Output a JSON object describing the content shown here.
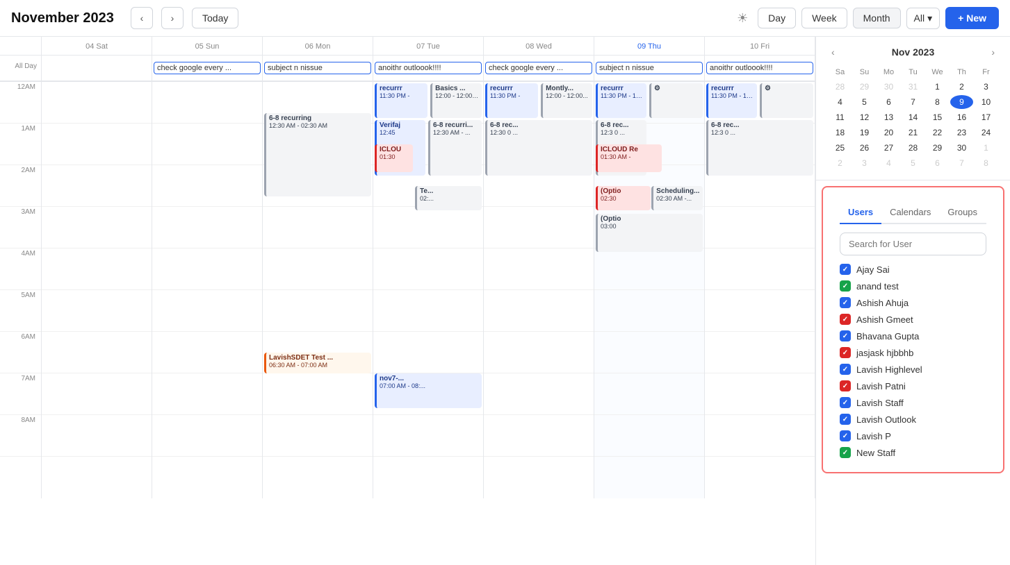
{
  "header": {
    "title": "November 2023",
    "today_label": "Today",
    "theme_icon": "☀",
    "view_day": "Day",
    "view_week": "Week",
    "view_month": "Month",
    "view_all": "All",
    "new_label": "+ New"
  },
  "allday_label": "All Day",
  "days": [
    {
      "date": "04",
      "name": "Sat",
      "today": false
    },
    {
      "date": "05",
      "name": "Sun",
      "today": false
    },
    {
      "date": "06",
      "name": "Mon",
      "today": false
    },
    {
      "date": "07",
      "name": "Tue",
      "today": false
    },
    {
      "date": "08",
      "name": "Wed",
      "today": false
    },
    {
      "date": "09",
      "name": "Thu",
      "today": true
    },
    {
      "date": "10",
      "name": "Fri",
      "today": false
    }
  ],
  "allday_events": [
    {
      "day": 1,
      "text": "check google every ...",
      "color": "blue"
    },
    {
      "day": 2,
      "text": "subject n nissue",
      "color": "blue"
    },
    {
      "day": 3,
      "text": "anoithr outloook!!!!",
      "color": "blue"
    },
    {
      "day": 4,
      "text": "check google every ...",
      "color": "blue"
    },
    {
      "day": 5,
      "text": "subject n nissue",
      "color": "blue"
    },
    {
      "day": 6,
      "text": "anoithr outloook!!!!",
      "color": "blue"
    }
  ],
  "time_labels": [
    "12AM",
    "1AM",
    "2AM",
    "3AM",
    "4AM",
    "5AM",
    "6AM",
    "7AM",
    "8AM"
  ],
  "mini_cal": {
    "title": "Nov 2023",
    "day_headers": [
      "Sa",
      "Su",
      "Mo",
      "Tu",
      "We",
      "Th",
      "Fr"
    ],
    "weeks": [
      [
        "28",
        "29",
        "30",
        "31",
        "1",
        "2",
        "3"
      ],
      [
        "4",
        "5",
        "6",
        "7",
        "8",
        "9",
        "10"
      ],
      [
        "11",
        "12",
        "13",
        "14",
        "15",
        "16",
        "17"
      ],
      [
        "18",
        "19",
        "20",
        "21",
        "22",
        "23",
        "24"
      ],
      [
        "25",
        "26",
        "27",
        "28",
        "29",
        "30",
        "1"
      ],
      [
        "2",
        "3",
        "4",
        "5",
        "6",
        "7",
        "8"
      ]
    ],
    "today": "9",
    "other_month_first_row": [
      true,
      true,
      true,
      true,
      false,
      false,
      false
    ],
    "other_month_last_row": [
      true,
      true,
      true,
      true,
      true,
      true,
      true
    ]
  },
  "panel": {
    "tabs": [
      "Users",
      "Calendars",
      "Groups"
    ],
    "active_tab": "Users",
    "search_placeholder": "Search for User",
    "users": [
      {
        "name": "Ajay Sai",
        "check": "blue"
      },
      {
        "name": "anand test",
        "check": "green"
      },
      {
        "name": "Ashish Ahuja",
        "check": "blue"
      },
      {
        "name": "Ashish Gmeet",
        "check": "red"
      },
      {
        "name": "Bhavana Gupta",
        "check": "blue"
      },
      {
        "name": "jasjask hjbbhb",
        "check": "red"
      },
      {
        "name": "Lavish Highlevel",
        "check": "blue"
      },
      {
        "name": "Lavish Patni",
        "check": "red"
      },
      {
        "name": "Lavish Staff",
        "check": "blue"
      },
      {
        "name": "Lavish Outlook",
        "check": "blue"
      },
      {
        "name": "Lavish P",
        "check": "blue"
      },
      {
        "name": "New Staff",
        "check": "green"
      }
    ]
  }
}
